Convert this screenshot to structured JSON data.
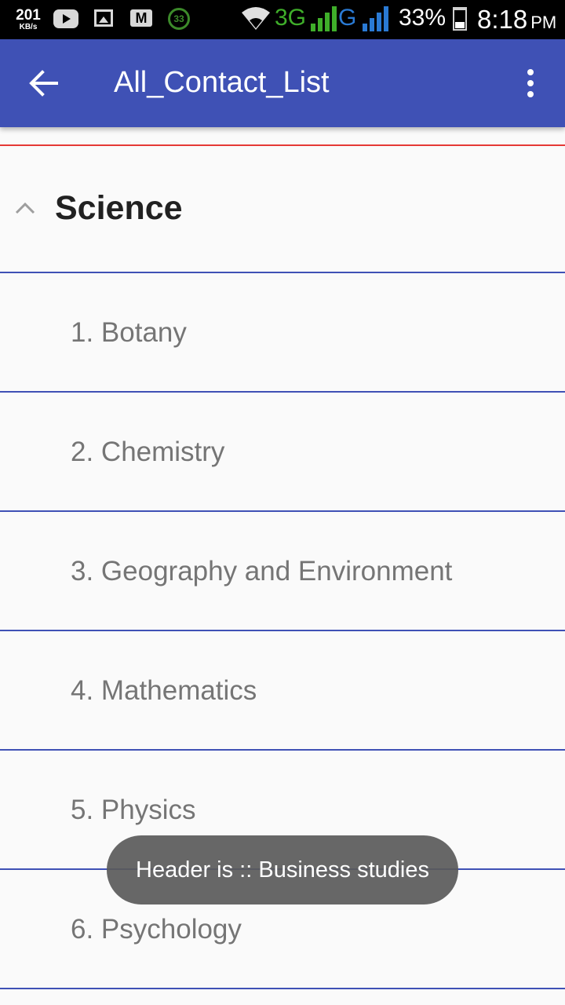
{
  "status_bar": {
    "net_speed_value": "201",
    "net_speed_unit": "KB/s",
    "notif_badge": "33",
    "network_3g": "3G",
    "network_g": "G",
    "battery_percent": "33%",
    "time": "8:18",
    "ampm": "PM",
    "icons": [
      "youtube-icon",
      "gallery-icon",
      "gmail-icon",
      "ring-badge-icon",
      "wifi-icon",
      "signal-icon",
      "battery-icon"
    ]
  },
  "app_bar": {
    "title": "All_Contact_List",
    "back_icon": "arrow-back-icon",
    "menu_icon": "more-vert-icon",
    "color": "#3f51b5"
  },
  "group": {
    "title": "Science",
    "expanded": true
  },
  "items": [
    {
      "label": "1. Botany"
    },
    {
      "label": "2. Chemistry"
    },
    {
      "label": "3. Geography and Environment"
    },
    {
      "label": "4. Mathematics"
    },
    {
      "label": "5. Physics"
    },
    {
      "label": "6. Psychology"
    }
  ],
  "toast": {
    "text": "Header is :: Business studies"
  },
  "colors": {
    "divider_red": "#e53935",
    "divider_blue": "#3f51b5"
  }
}
